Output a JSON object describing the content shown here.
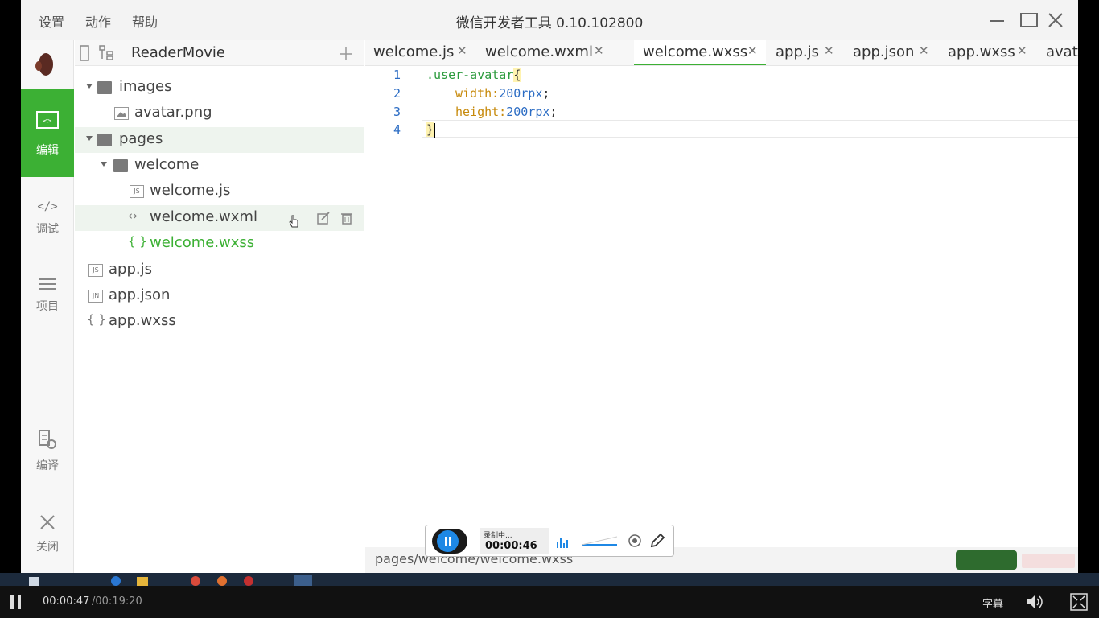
{
  "window": {
    "title": "微信开发者工具 0.10.102800",
    "menu": [
      "设置",
      "动作",
      "帮助"
    ]
  },
  "sidebar": {
    "items": [
      {
        "label": "编辑",
        "icon": "code-icon",
        "active": true
      },
      {
        "label": "调试",
        "icon": "debug-icon",
        "active": false
      },
      {
        "label": "项目",
        "icon": "list-icon",
        "active": false
      },
      {
        "label": "编译",
        "icon": "compile-icon",
        "active": false
      },
      {
        "label": "关闭",
        "icon": "close-icon",
        "active": false
      }
    ]
  },
  "tree": {
    "project_name": "ReaderMovie",
    "rows": [
      {
        "name": "images"
      },
      {
        "name": "avatar.png"
      },
      {
        "name": "pages"
      },
      {
        "name": "welcome"
      },
      {
        "name": "welcome.js",
        "badge": "JS"
      },
      {
        "name": "welcome.wxml"
      },
      {
        "name": "welcome.wxss"
      },
      {
        "name": "app.js",
        "badge": "JS"
      },
      {
        "name": "app.json",
        "badge": "JN"
      },
      {
        "name": "app.wxss"
      }
    ]
  },
  "editor": {
    "tabs": [
      {
        "label": "welcome.js"
      },
      {
        "label": "welcome.wxml"
      },
      {
        "label": "welcome.wxss",
        "active": true
      },
      {
        "label": "app.js"
      },
      {
        "label": "app.json"
      },
      {
        "label": "app.wxss"
      },
      {
        "label": "avatar.p"
      }
    ],
    "line_numbers": [
      "1",
      "2",
      "3",
      "4"
    ],
    "code": {
      "selector": ".user-avatar",
      "open_brace": "{",
      "prop1": "width:",
      "val1": "200rpx",
      "prop2": "height:",
      "val2": "200rpx",
      "semicolon": ";",
      "close_brace": "}"
    },
    "status_path": "pages/welcome/welcome.wxss"
  },
  "recorder": {
    "status": "录制中...",
    "time": "00:00:46"
  },
  "player": {
    "current": "00:00:47",
    "total": "/00:19:20",
    "subtitle": "字幕"
  },
  "colors": {
    "accent": "#3cb034",
    "selector": "#2b9a3c",
    "property": "#c78a0c",
    "value": "#2b6cc4"
  }
}
